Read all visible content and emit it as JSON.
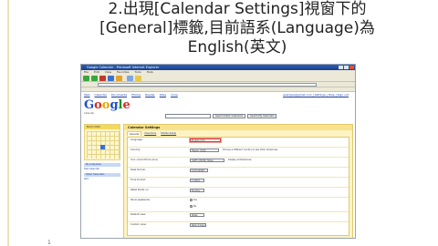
{
  "slide": {
    "title_line1": "2.出現[Calendar Settings]視窗下的",
    "title_line2": "[General]標籤,目前語系(Language)為",
    "title_line3": "English(英文)",
    "slide_number": "1"
  },
  "browser": {
    "window_title": "Google Calendar - Microsoft Internet Explorer",
    "menu": [
      "File",
      "Edit",
      "View",
      "Favorites",
      "Tools",
      "Help"
    ]
  },
  "google": {
    "nav_links": [
      "Web",
      "Calendar",
      "Documents",
      "Photos",
      "Reader",
      "Sites",
      "more"
    ],
    "user_links": "example@gmail.com | Settings | Help | Sign out",
    "logo_letters": [
      "G",
      "o",
      "o",
      "g",
      "l",
      "e"
    ],
    "logo_sub": "Calendar",
    "search_buttons": [
      "Search Public Calendars",
      "Search My Calendars"
    ]
  },
  "sidebar": {
    "mini_cal_header": "March 2009",
    "my_calendars_label": "My Calendars",
    "my_calendar_item": "Test Calendar",
    "other_calendars_label": "Other Calendars",
    "other_calendar_item": "Add"
  },
  "settings": {
    "header": "Calendar Settings",
    "tabs": [
      "General",
      "Calendars",
      "Mobile Setup"
    ],
    "rows": [
      {
        "label": "Language:",
        "value": "English (US)"
      },
      {
        "label": "Country:",
        "value": "Taiwan (台灣)",
        "note": "Choose a different country to see other timezones"
      },
      {
        "label": "Your current time zone:",
        "value": "(GMT+08:00) Taipei",
        "note": "Display all timezones"
      },
      {
        "label": "Date format:",
        "value": "12/31/2009"
      },
      {
        "label": "Time format:",
        "value": "1:00pm"
      },
      {
        "label": "Week starts on:",
        "value": "Sunday"
      },
      {
        "label": "Show weekends:",
        "radio_yes": "Yes",
        "radio_no": "No"
      },
      {
        "label": "Default view:",
        "value": "Week"
      },
      {
        "label": "Custom view:",
        "value": "Next 4 Days"
      }
    ]
  }
}
